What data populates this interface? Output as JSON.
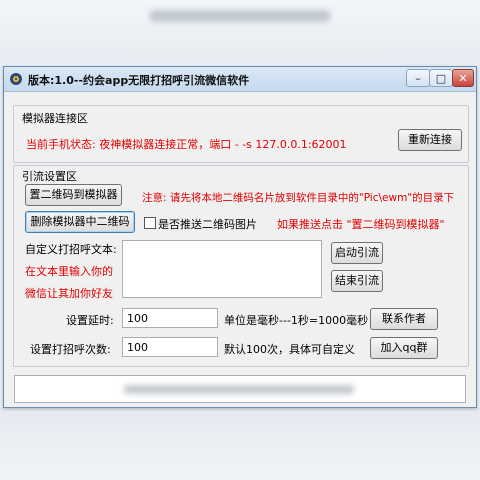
{
  "window": {
    "title": "版本:1.0--约会app无限打招呼引流微信软件"
  },
  "emulator_group": {
    "title": "模拟器连接区",
    "status_text": "当前手机状态: 夜神模拟器连接正常，端口 -   -s  127.0.0.1:62001",
    "reconnect_label": "重新连接"
  },
  "lead_group": {
    "title": "引流设置区",
    "set_qr_label": "置二维码到模拟器",
    "notice_text": "注意: 请先将本地二维码名片放到软件目录中的\"Pic\\ewm\"的目录下",
    "delete_qr_label": "删除模拟器中二维码",
    "push_qr_label": "是否推送二维码图片",
    "push_hint": "如果推送点击 \"置二维码到模拟器\"",
    "greeting_label": "自定义打招呼文本:",
    "greeting_hint_line1": "在文本里输入你的",
    "greeting_hint_line2": "微信让其加你好友",
    "start_label": "启动引流",
    "stop_label": "结束引流",
    "delay_label": "设置延时:",
    "delay_value": "100",
    "delay_unit": "单位是毫秒---1秒=1000毫秒",
    "contact_label": "联系作者",
    "count_label": "设置打招呼次数:",
    "count_value": "100",
    "count_hint": "默认100次，具体可自定义",
    "join_group_label": "加入qq群"
  }
}
